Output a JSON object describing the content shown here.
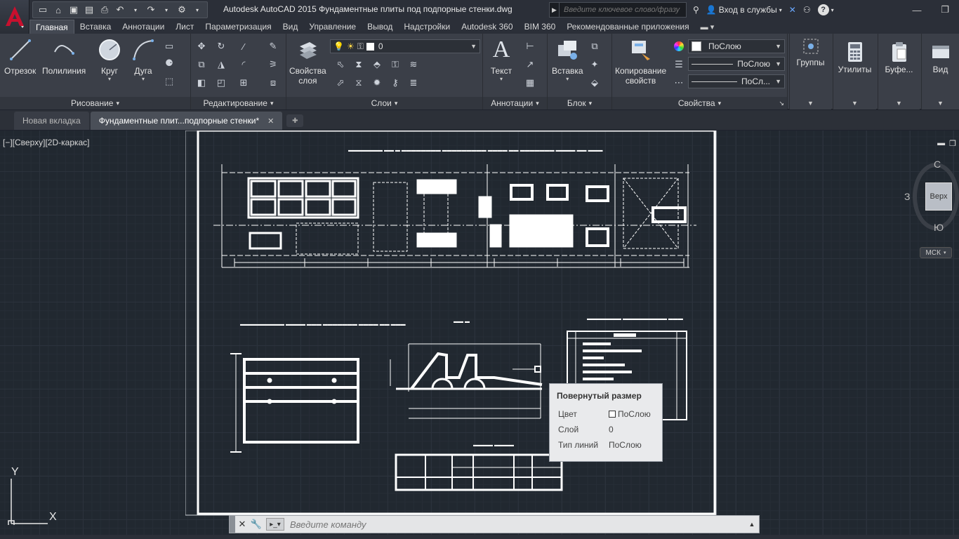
{
  "window": {
    "title": "Autodesk AutoCAD 2015   Фундаментные плиты под подпорные стенки.dwg",
    "search_placeholder": "Введите ключевое слово/фразу",
    "sign_in": "Вход в службы"
  },
  "ribbon_tabs": [
    "Главная",
    "Вставка",
    "Аннотации",
    "Лист",
    "Параметризация",
    "Вид",
    "Управление",
    "Вывод",
    "Надстройки",
    "Autodesk 360",
    "BIM 360",
    "Рекомендованные приложения"
  ],
  "panels": {
    "draw": {
      "title": "Рисование",
      "line": "Отрезок",
      "polyline": "Полилиния",
      "circle": "Круг",
      "arc": "Дуга"
    },
    "modify": {
      "title": "Редактирование"
    },
    "layers": {
      "title": "Слои",
      "properties_line1": "Свойства",
      "properties_line2": "слоя",
      "current_layer": "0"
    },
    "annotation": {
      "title": "Аннотации",
      "text": "Текст"
    },
    "block": {
      "title": "Блок",
      "insert": "Вставка"
    },
    "properties": {
      "title": "Свойства",
      "match_line1": "Копирование",
      "match_line2": "свойств",
      "color": "ПоСлою",
      "linetype": "ПоСлою",
      "lineweight": "ПоСл..."
    },
    "groups": "Группы",
    "utilities": "Утилиты",
    "clipboard": "Буфе...",
    "view": "Вид"
  },
  "file_tabs": [
    {
      "label": "Новая вкладка"
    },
    {
      "label": "Фундаментные плит...подпорные стенки*"
    }
  ],
  "viewport": {
    "label": "[−][Сверху][2D-каркас]"
  },
  "viewcube": {
    "north": "С",
    "south": "Ю",
    "west": "З",
    "face": "Верх",
    "ucs_menu": "МСК"
  },
  "ucs": {
    "x": "X",
    "y": "Y"
  },
  "tooltip": {
    "title": "Повернутый размер",
    "color_label": "Цвет",
    "color_value": "ПоСлою",
    "layer_label": "Слой",
    "layer_value": "0",
    "linetype_label": "Тип линий",
    "linetype_value": "ПоСлою"
  },
  "command": {
    "placeholder": "Введите команду"
  },
  "colors": {
    "ribbon_bg": "#3b3f48",
    "canvas_bg": "#212830",
    "accent_red": "#c8102e"
  }
}
